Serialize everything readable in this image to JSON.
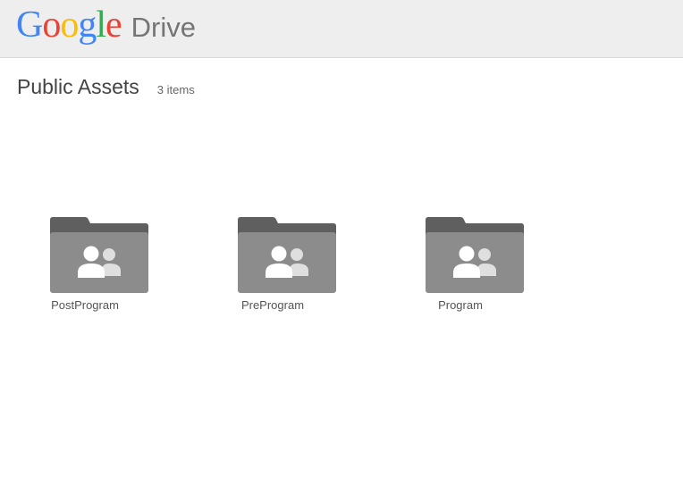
{
  "header": {
    "logo_letters": [
      {
        "char": "G",
        "color": "#4285f4"
      },
      {
        "char": "o",
        "color": "#ea4335"
      },
      {
        "char": "o",
        "color": "#fbbc05"
      },
      {
        "char": "g",
        "color": "#4285f4"
      },
      {
        "char": "l",
        "color": "#34a853"
      },
      {
        "char": "e",
        "color": "#ea4335"
      }
    ],
    "product_name": "Drive"
  },
  "main": {
    "title": "Public Assets",
    "item_count": "3 items",
    "folders": [
      {
        "name": "PostProgram",
        "icon": "shared-folder-icon"
      },
      {
        "name": "PreProgram",
        "icon": "shared-folder-icon"
      },
      {
        "name": "Program",
        "icon": "shared-folder-icon"
      }
    ]
  },
  "colors": {
    "header_bg": "#eeeeee",
    "folder_tab": "#5f5f5f",
    "folder_body": "#8c8c8c",
    "folder_people": "#ffffff"
  }
}
